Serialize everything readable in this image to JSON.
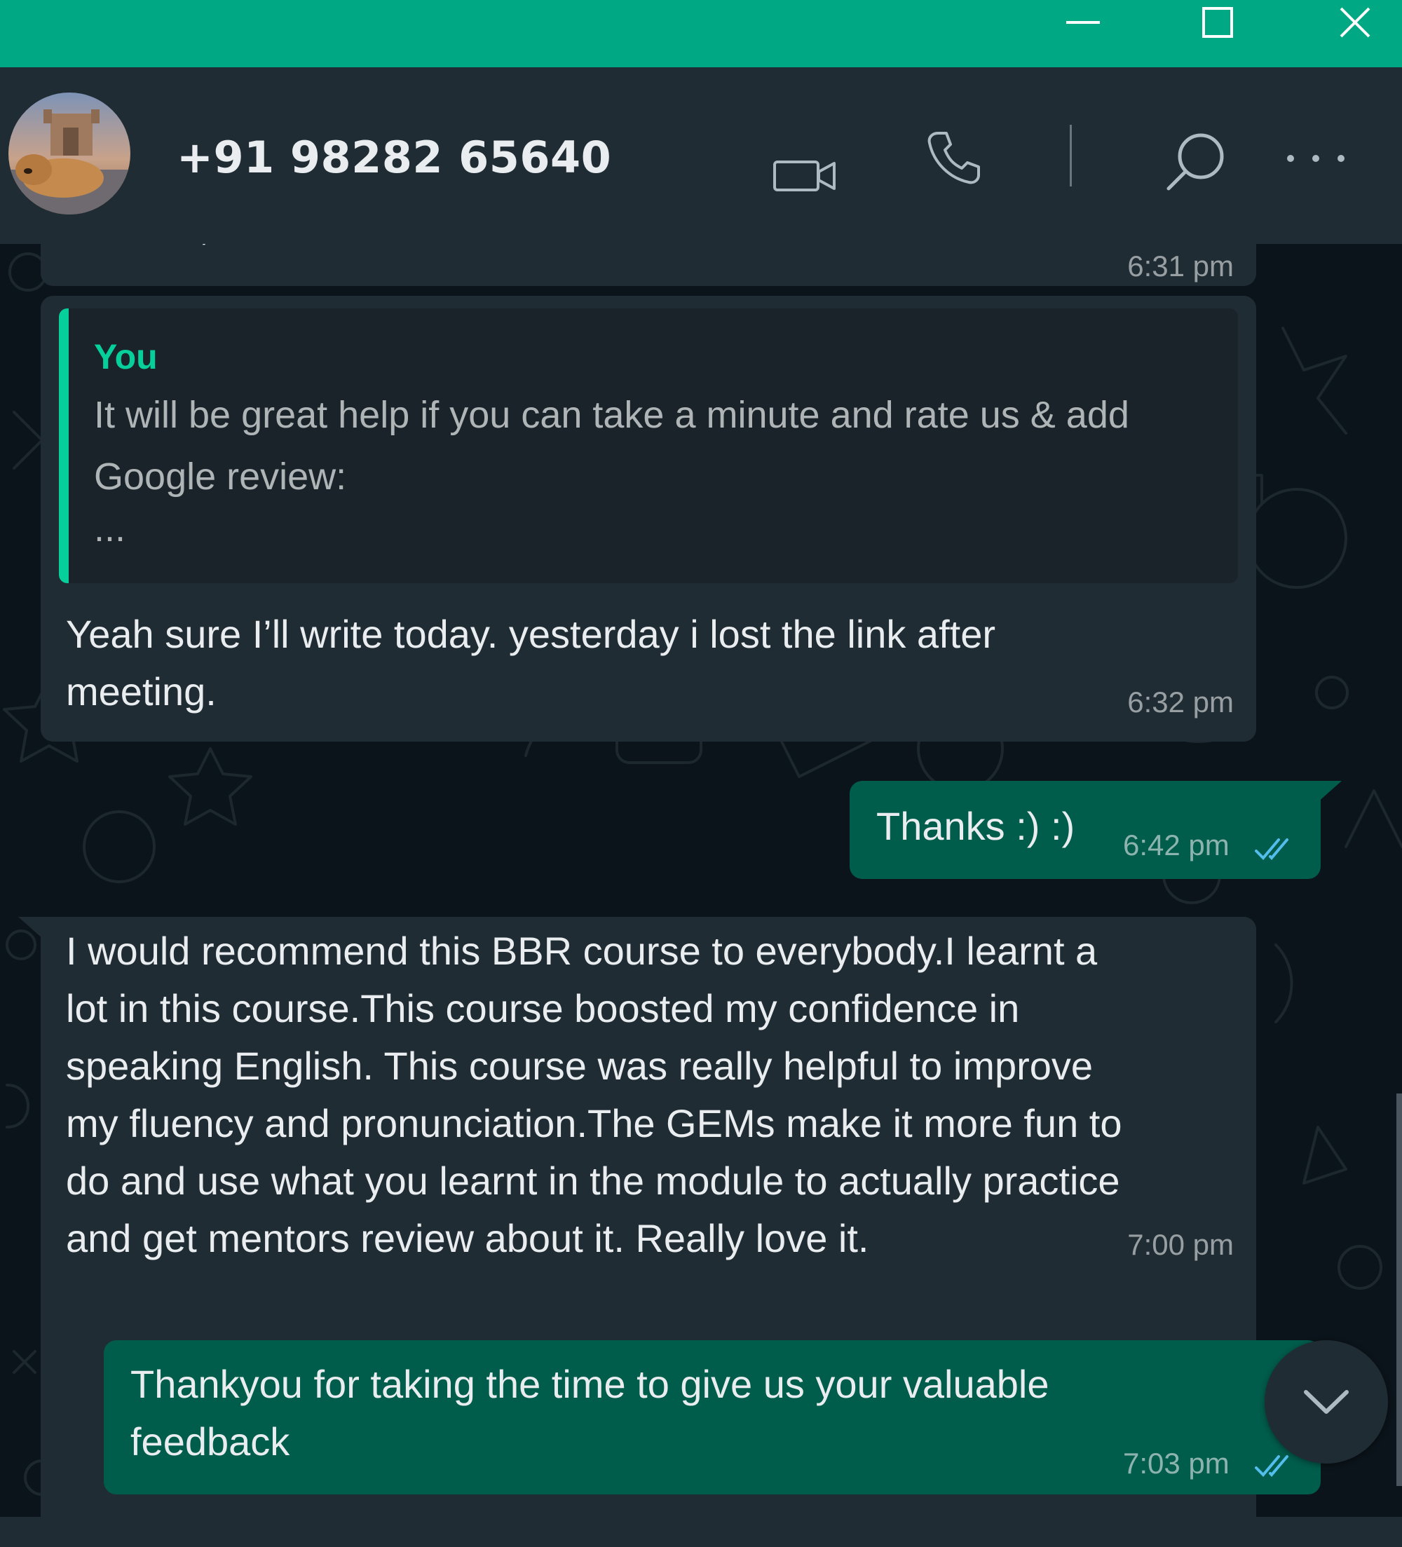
{
  "window": {
    "minimize_icon": "minimize-icon",
    "maximize_icon": "maximize-icon",
    "close_icon": "close-icon"
  },
  "header": {
    "contact_name": "+91 98282 65640",
    "icons": [
      "video-call-icon",
      "voice-call-icon",
      "search-icon",
      "more-options-icon"
    ]
  },
  "messages": [
    {
      "direction": "incoming",
      "text_partial": "Sure sir, I'll send in while.",
      "time": "6:31 pm"
    },
    {
      "direction": "incoming",
      "quote": {
        "author": "You",
        "line1": "It will be great help if you can take a minute and rate us & add",
        "line2": "Google review:",
        "line3": "..."
      },
      "line1": "Yeah sure I’ll write today. yesterday i lost the link after",
      "line2": "meeting.",
      "time": "6:32 pm"
    },
    {
      "direction": "outgoing",
      "text": "Thanks :) :)",
      "time": "6:42 pm",
      "status": "read"
    },
    {
      "direction": "incoming",
      "lines": [
        "I would recommend this BBR course to everybody.I learnt a",
        "lot in this course.This course boosted my confidence in",
        "speaking English. This course was really helpful to improve",
        "my fluency and pronunciation.The GEMs make it more fun to",
        "do and use what you learnt in the module to actually practice",
        "and get mentors review about it. Really love it."
      ],
      "time": "7:00 pm"
    },
    {
      "direction": "outgoing",
      "line1": "Thankyou for taking the time to give us your valuable",
      "line2": "feedback",
      "time": "7:03 pm",
      "status": "read"
    }
  ],
  "colors": {
    "titlebar": "#00a884",
    "header": "#202c33",
    "chat_bg": "#0b141a",
    "incoming_bubble": "#202c33",
    "outgoing_bubble": "#005c4b",
    "accent": "#06cf9c",
    "read_ticks": "#53bdeb"
  }
}
